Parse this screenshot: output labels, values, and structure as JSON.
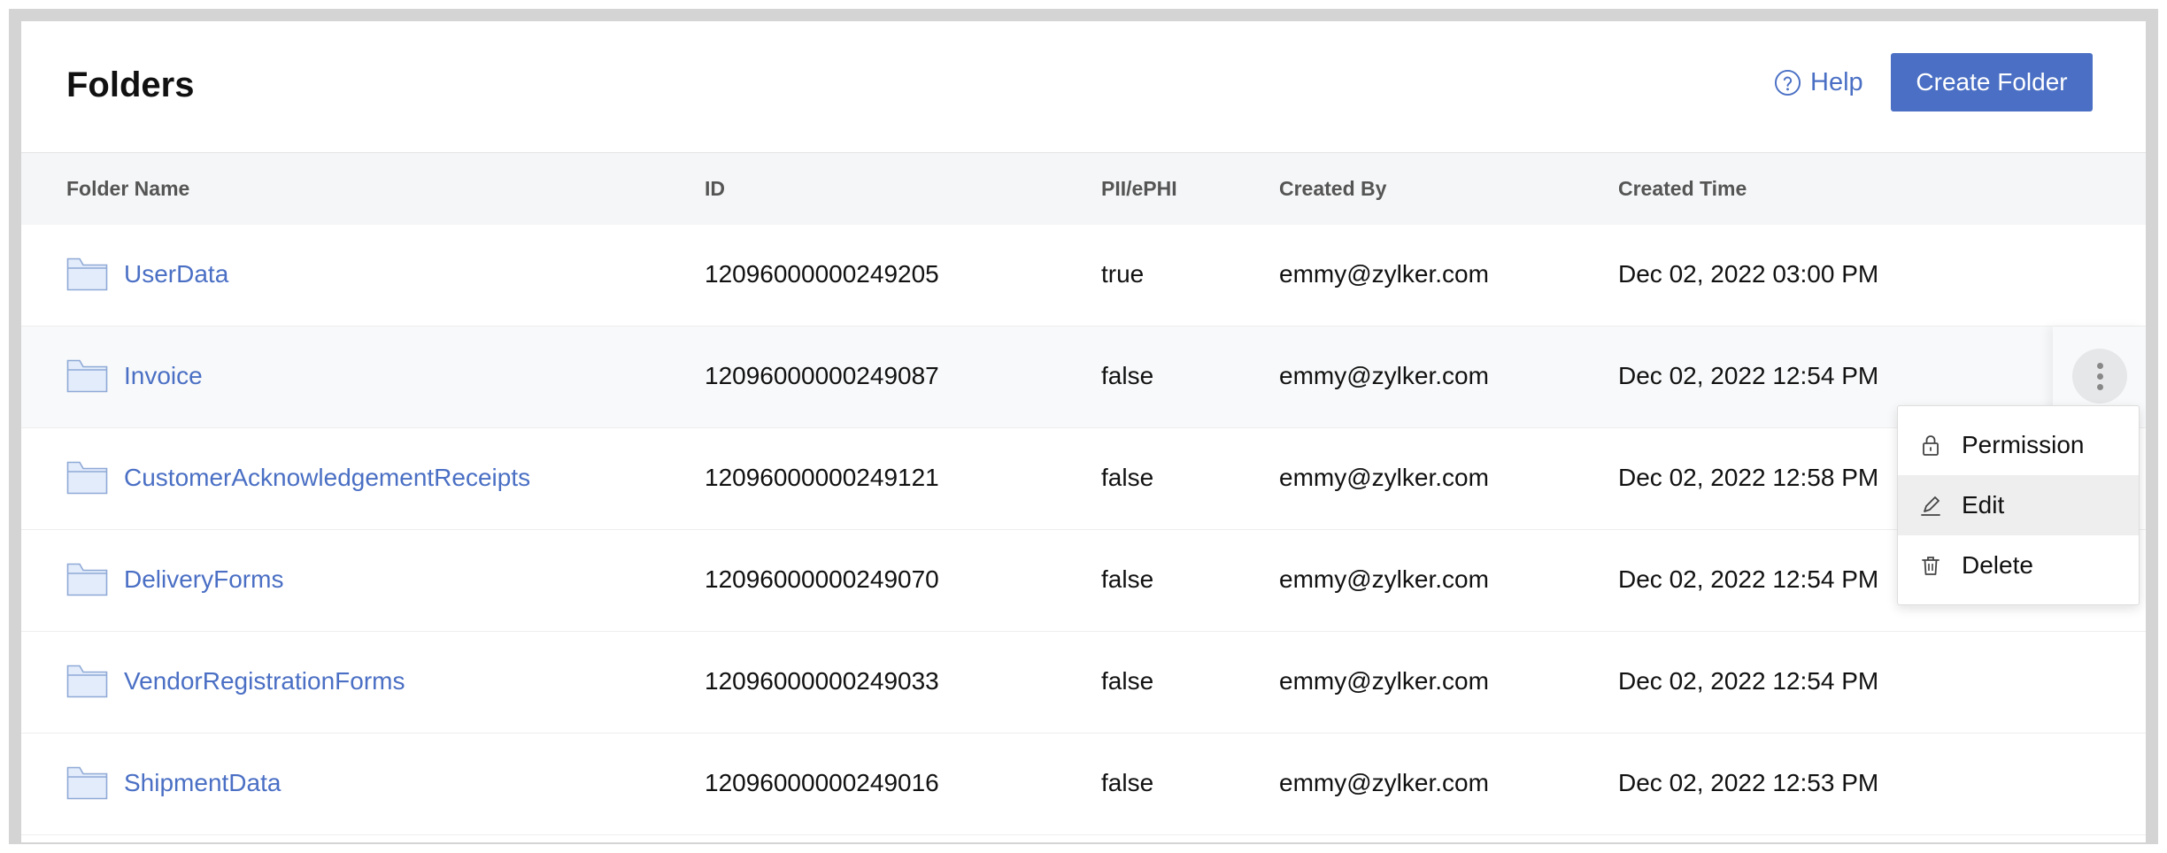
{
  "header": {
    "title": "Folders",
    "help_label": "Help",
    "create_label": "Create Folder"
  },
  "colors": {
    "accent": "#4a6fc4",
    "header_bg": "#f5f6f7",
    "folder_icon_fill": "#e3ecfb"
  },
  "columns": [
    "Folder Name",
    "ID",
    "PII/ePHI",
    "Created By",
    "Created Time"
  ],
  "rows": [
    {
      "name": "UserData",
      "id": "12096000000249205",
      "pii": "true",
      "created_by": "emmy@zylker.com",
      "created_time": "Dec 02, 2022 03:00 PM"
    },
    {
      "name": "Invoice",
      "id": "12096000000249087",
      "pii": "false",
      "created_by": "emmy@zylker.com",
      "created_time": "Dec 02, 2022 12:54 PM"
    },
    {
      "name": "CustomerAcknowledgementReceipts",
      "id": "12096000000249121",
      "pii": "false",
      "created_by": "emmy@zylker.com",
      "created_time": "Dec 02, 2022 12:58 PM"
    },
    {
      "name": "DeliveryForms",
      "id": "12096000000249070",
      "pii": "false",
      "created_by": "emmy@zylker.com",
      "created_time": "Dec 02, 2022 12:54 PM"
    },
    {
      "name": "VendorRegistrationForms",
      "id": "12096000000249033",
      "pii": "false",
      "created_by": "emmy@zylker.com",
      "created_time": "Dec 02, 2022 12:54 PM"
    },
    {
      "name": "ShipmentData",
      "id": "12096000000249016",
      "pii": "false",
      "created_by": "emmy@zylker.com",
      "created_time": "Dec 02, 2022 12:53 PM"
    }
  ],
  "row_menu": {
    "items": [
      {
        "label": "Permission",
        "icon": "lock-icon"
      },
      {
        "label": "Edit",
        "icon": "pencil-icon"
      },
      {
        "label": "Delete",
        "icon": "trash-icon"
      }
    ]
  }
}
